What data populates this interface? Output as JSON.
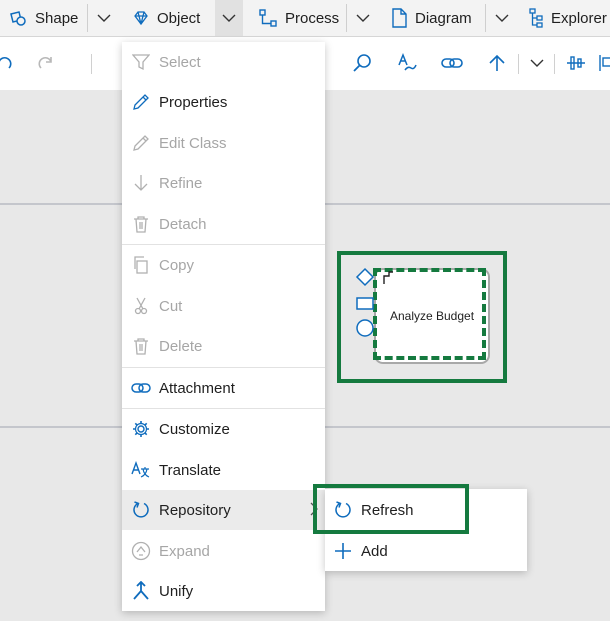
{
  "menubar": {
    "shape_label": "Shape",
    "object_label": "Object",
    "process_label": "Process",
    "diagram_label": "Diagram",
    "explorer_label": "Explorer"
  },
  "canvas": {
    "shape_text": "Analyze Budget",
    "highlight_color": "#157a3f"
  },
  "context_menu": {
    "items": [
      {
        "label": "Select",
        "icon": "funnel-icon",
        "enabled": false
      },
      {
        "label": "Properties",
        "icon": "pencil-icon",
        "enabled": true
      },
      {
        "label": "Edit Class",
        "icon": "pencil-icon",
        "enabled": false
      },
      {
        "label": "Refine",
        "icon": "arrow-down-icon",
        "enabled": false
      },
      {
        "label": "Detach",
        "icon": "trash-icon",
        "enabled": false
      },
      {
        "label": "Copy",
        "icon": "copy-icon",
        "enabled": false
      },
      {
        "label": "Cut",
        "icon": "scissors-icon",
        "enabled": false
      },
      {
        "label": "Delete",
        "icon": "trash-icon",
        "enabled": false
      },
      {
        "label": "Attachment",
        "icon": "link-icon",
        "enabled": true
      },
      {
        "label": "Customize",
        "icon": "gear-icon",
        "enabled": true
      },
      {
        "label": "Translate",
        "icon": "translate-icon",
        "enabled": true
      },
      {
        "label": "Repository",
        "icon": "refresh-icon",
        "enabled": true,
        "has_submenu": true
      },
      {
        "label": "Expand",
        "icon": "expand-icon",
        "enabled": false
      },
      {
        "label": "Unify",
        "icon": "merge-icon",
        "enabled": true
      }
    ]
  },
  "submenu": {
    "items": [
      {
        "label": "Refresh",
        "icon": "refresh-icon"
      },
      {
        "label": "Add",
        "icon": "plus-icon"
      }
    ]
  }
}
